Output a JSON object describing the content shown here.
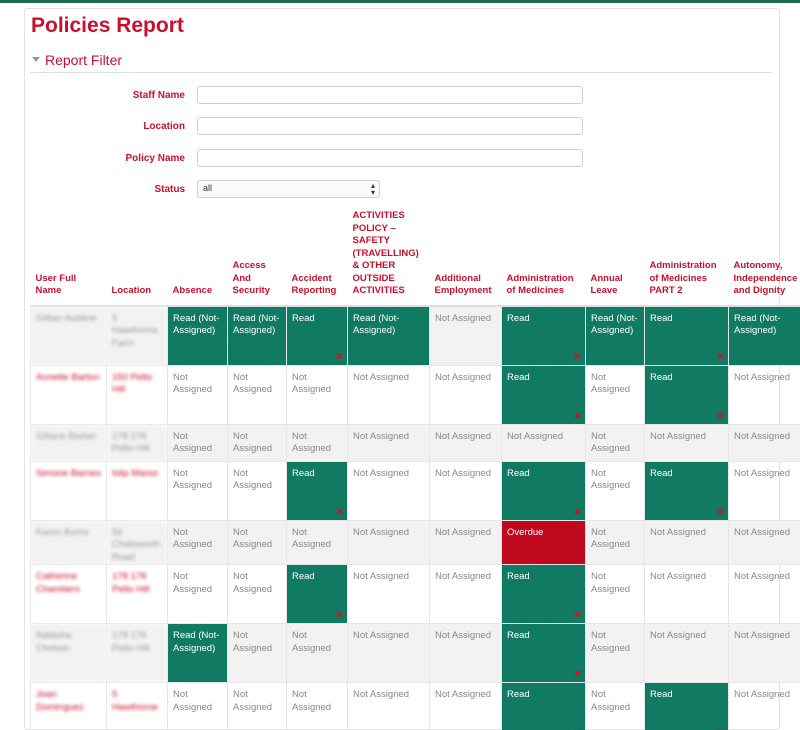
{
  "page": {
    "title": "Policies Report"
  },
  "filter": {
    "heading": "Report Filter",
    "staff_name_label": "Staff Name",
    "location_label": "Location",
    "policy_name_label": "Policy Name",
    "status_label": "Status",
    "status_value": "all"
  },
  "table": {
    "headers": {
      "user": "User Full Name",
      "location": "Location",
      "c0": "Absence",
      "c1": "Access And Security",
      "c2": "Accident Reporting",
      "c3": "ACTIVITIES POLICY – SAFETY (TRAVELLING) & OTHER OUTSIDE ACTIVITIES",
      "c4": "Additional Employment",
      "c5": "Administration of Medicines",
      "c6": "Annual Leave",
      "c7": "Administration of Medicines PART 2",
      "c8": "Autonomy, Independence and Dignity"
    },
    "rows": [
      {
        "user": "Gillian Austine",
        "location": "5 Hawthorne Farm",
        "c0": "Read (Not-Assigned)",
        "c1": "Read (Not-Assigned)",
        "c2": "Read",
        "c3": "Read (Not-Assigned)",
        "c4": "Not Assigned",
        "c5": "Read",
        "c6": "Read (Not-Assigned)",
        "c7": "Read",
        "c8": "Read (Not-Assigned)"
      },
      {
        "user": "Annette Barton",
        "location": "150 Pelto Hill",
        "c0": "Not Assigned",
        "c1": "Not Assigned",
        "c2": "Not Assigned",
        "c3": "Not Assigned",
        "c4": "Not Assigned",
        "c5": "Read",
        "c6": "Not Assigned",
        "c7": "Read",
        "c8": "Not Assigned"
      },
      {
        "user": "Gillane Barber",
        "location": "178 178 Pelto Hill",
        "c0": "Not Assigned",
        "c1": "Not Assigned",
        "c2": "Not Assigned",
        "c3": "Not Assigned",
        "c4": "Not Assigned",
        "c5": "Not Assigned",
        "c6": "Not Assigned",
        "c7": "Not Assigned",
        "c8": "Not Assigned"
      },
      {
        "user": "Simone Barnes",
        "location": "Islip Manor",
        "c0": "Not Assigned",
        "c1": "Not Assigned",
        "c2": "Read",
        "c3": "Not Assigned",
        "c4": "Not Assigned",
        "c5": "Read",
        "c6": "Not Assigned",
        "c7": "Read",
        "c8": "Not Assigned"
      },
      {
        "user": "Karen Burns",
        "location": "56 Chatsworth Road",
        "c0": "Not Assigned",
        "c1": "Not Assigned",
        "c2": "Not Assigned",
        "c3": "Not Assigned",
        "c4": "Not Assigned",
        "c5": "Overdue",
        "c6": "Not Assigned",
        "c7": "Not Assigned",
        "c8": "Not Assigned"
      },
      {
        "user": "Catherine Chambers",
        "location": "178 178 Pelto Hill",
        "c0": "Not Assigned",
        "c1": "Not Assigned",
        "c2": "Read",
        "c3": "Not Assigned",
        "c4": "Not Assigned",
        "c5": "Read",
        "c6": "Not Assigned",
        "c7": "Not Assigned",
        "c8": "Not Assigned"
      },
      {
        "user": "Natasha Chetwin",
        "location": "178 178 Pelto Hill",
        "c0": "Read (Not-Assigned)",
        "c1": "Not Assigned",
        "c2": "Not Assigned",
        "c3": "Not Assigned",
        "c4": "Not Assigned",
        "c5": "Read",
        "c6": "Not Assigned",
        "c7": "Not Assigned",
        "c8": "Not Assigned"
      },
      {
        "user": "Joan Dominguez",
        "location": "5 Hawthorne",
        "c0": "Not Assigned",
        "c1": "Not Assigned",
        "c2": "Not Assigned",
        "c3": "Not Assigned",
        "c4": "Not Assigned",
        "c5": "Read",
        "c6": "Not Assigned",
        "c7": "Read",
        "c8": "Not Assigned"
      }
    ]
  },
  "colors": {
    "brand_red": "#c8102e",
    "read_green": "#117a62",
    "overdue_red": "#c0081e"
  }
}
